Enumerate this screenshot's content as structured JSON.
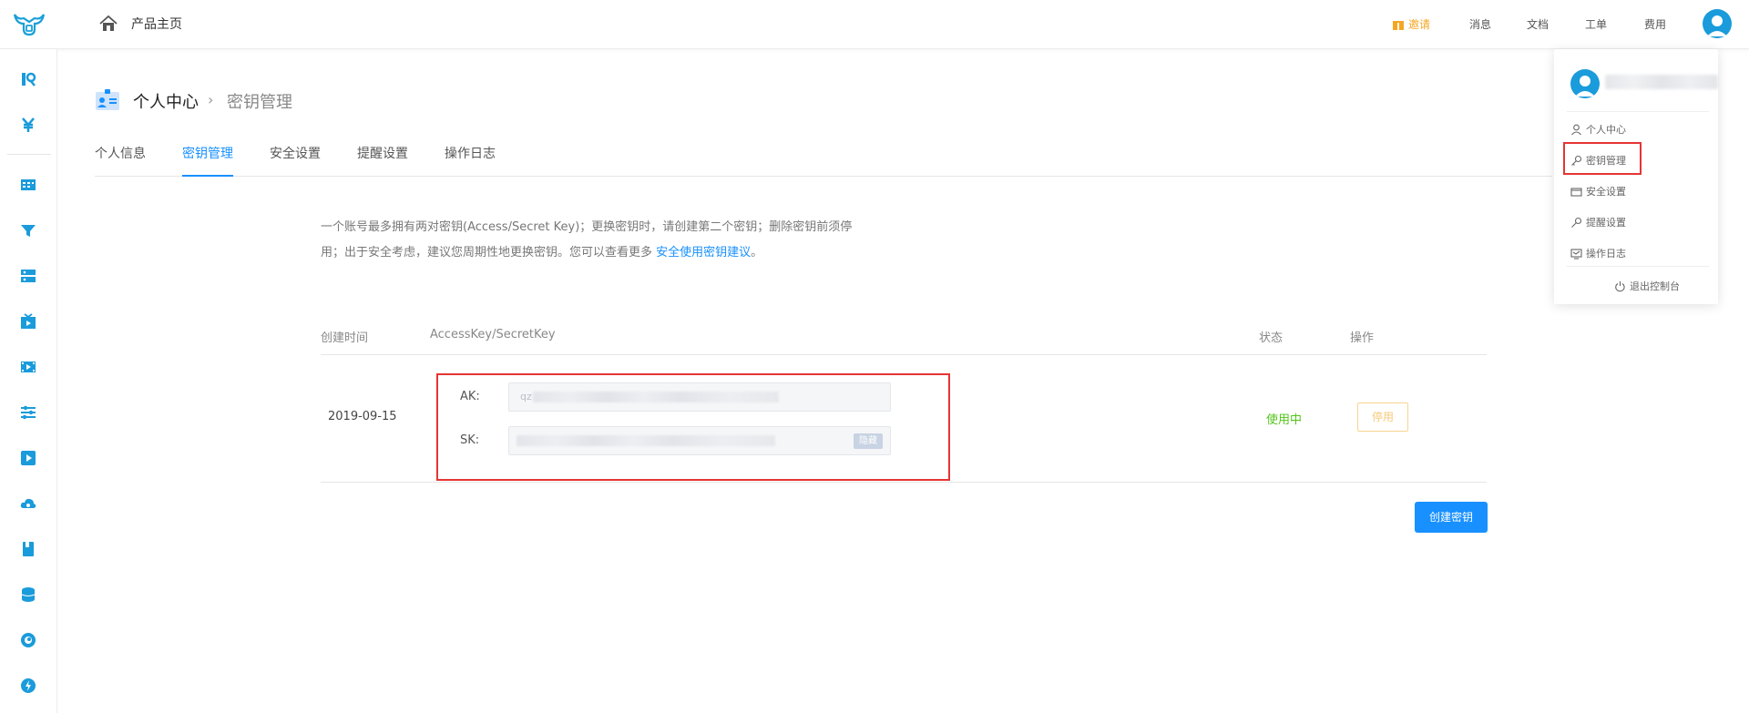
{
  "topbar": {
    "home_label": "产品主页",
    "invite_label": "邀请",
    "links": [
      "消息",
      "文档",
      "工单",
      "费用"
    ]
  },
  "sidebar": {
    "icons": [
      "brand-r-icon",
      "yen-icon",
      "dashboard-icon",
      "funnel-icon",
      "server-icon",
      "tv-icon",
      "film-icon",
      "sliders-icon",
      "play-icon",
      "cloud-icon",
      "book-icon",
      "database-icon",
      "circle-icon",
      "bolt-icon"
    ]
  },
  "page": {
    "breadcrumb_main": "个人中心",
    "breadcrumb_sep": "›",
    "breadcrumb_sub": "密钥管理",
    "tabs": [
      "个人信息",
      "密钥管理",
      "安全设置",
      "提醒设置",
      "操作日志"
    ],
    "active_tab": "密钥管理",
    "description_line1": "一个账号最多拥有两对密钥(Access/Secret Key)；更换密钥时，请创建第二个密钥；删除密钥前须停",
    "description_line2": "用；出于安全考虑，建议您周期性地更换密钥。您可以查看更多 ",
    "description_link": "安全使用密钥建议",
    "description_end": "。"
  },
  "table": {
    "headers": {
      "created": "创建时间",
      "keys": "AccessKey/SecretKey",
      "status": "状态",
      "action": "操作"
    },
    "rows": [
      {
        "created": "2019-09-15",
        "ak_label": "AK:",
        "ak_prefix": "qz",
        "sk_label": "SK:",
        "hide_label": "隐藏",
        "status": "使用中",
        "action_label": "停用"
      }
    ]
  },
  "create_button": "创建密钥",
  "dropdown": {
    "items": [
      "个人中心",
      "密钥管理",
      "安全设置",
      "提醒设置",
      "操作日志"
    ],
    "logout": "退出控制台"
  },
  "colors": {
    "primary": "#1890ff",
    "success": "#52c41a",
    "warning": "#f5a623",
    "highlight_box": "#e63434",
    "avatar": "#1a9bdb"
  }
}
